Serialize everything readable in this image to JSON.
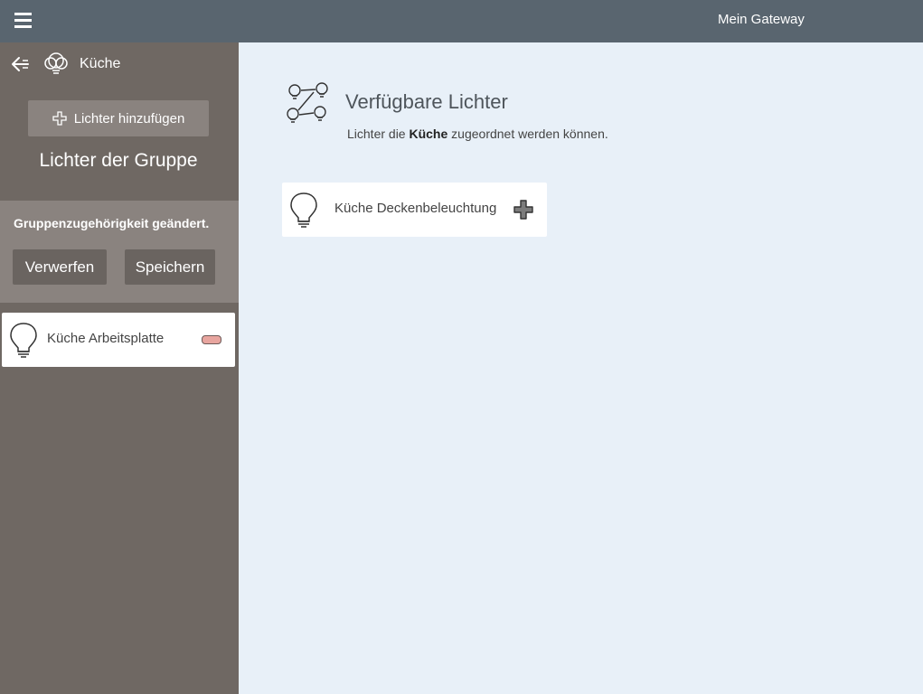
{
  "topbar": {
    "title": "Mein Gateway"
  },
  "sidebar": {
    "group_name": "Küche",
    "add_lights_label": "Lichter hinzufügen",
    "group_lights_title": "Lichter der Gruppe",
    "change_notice": "Gruppenzugehörigkeit geändert.",
    "discard_label": "Verwerfen",
    "save_label": "Speichern",
    "lights": [
      {
        "name": "Küche Arbeitsplatte"
      }
    ]
  },
  "main": {
    "title": "Verfügbare Lichter",
    "subtitle_prefix": "Lichter die ",
    "subtitle_group": "Küche",
    "subtitle_suffix": " zugeordnet werden können.",
    "lights": [
      {
        "name": "Küche Deckenbeleuchtung"
      }
    ]
  },
  "colors": {
    "topbar": "#59656f",
    "sidebar": "#6f6863",
    "panel": "#8a837f",
    "main_bg": "#e8f0f8",
    "remove_accent": "#e8a59f"
  }
}
